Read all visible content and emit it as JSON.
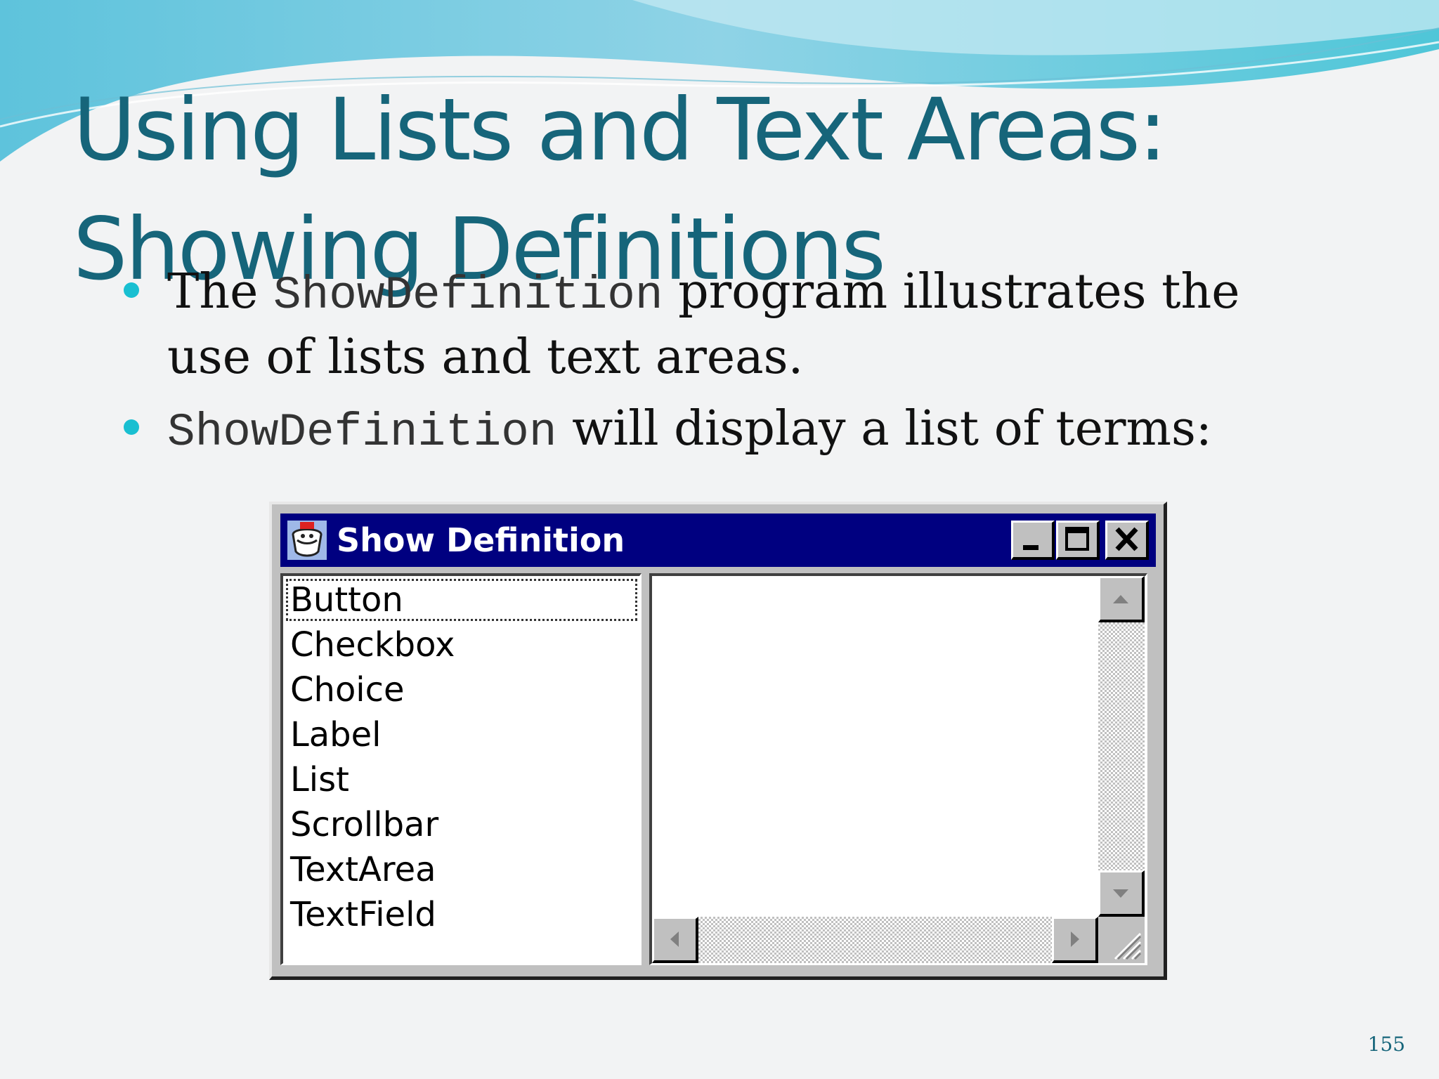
{
  "slide": {
    "title_line1": "Using Lists and Text Areas:",
    "title_line2": "Showing Definitions",
    "bullet1": {
      "pre": "The ",
      "code": "ShowDefinition",
      "post": " program illustrates the use of lists and text areas."
    },
    "bullet2": {
      "code": "ShowDefinition",
      "post": " will display a list of terms:"
    },
    "page_number": "155"
  },
  "window": {
    "title": "Show Definition",
    "list_items": [
      "Button",
      "Checkbox",
      "Choice",
      "Label",
      "List",
      "Scrollbar",
      "TextArea",
      "TextField"
    ],
    "focused_item": "Button",
    "text_area_value": ""
  },
  "colors": {
    "title": "#16657a",
    "bullet": "#19bfd1",
    "titlebar": "#000080"
  },
  "icons": [
    "app-icon",
    "minimize-icon",
    "maximize-icon",
    "close-icon",
    "scroll-up-icon",
    "scroll-down-icon",
    "scroll-left-icon",
    "scroll-right-icon",
    "resize-grip-icon"
  ]
}
